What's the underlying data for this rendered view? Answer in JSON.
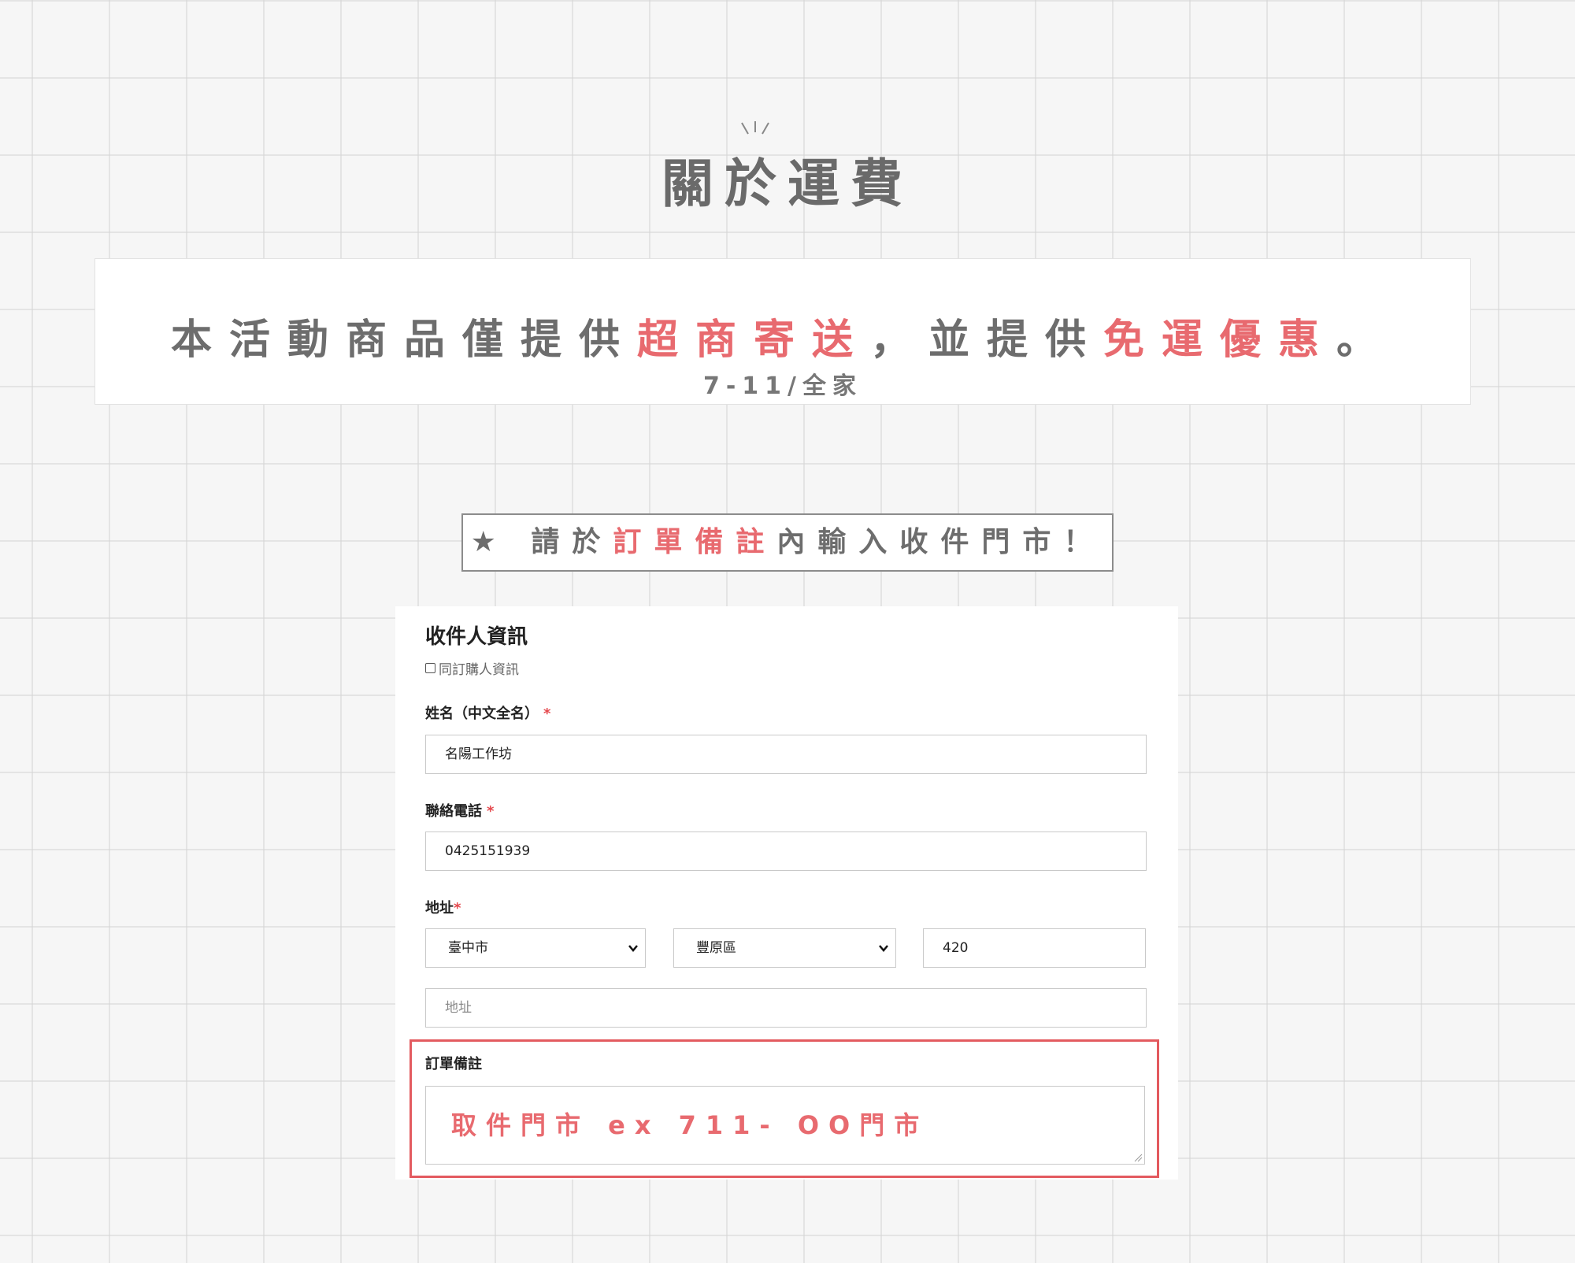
{
  "header": {
    "title": "關於運費",
    "sparkle_icon": "sparkle-icon"
  },
  "banner": {
    "segments": [
      "本活動商品僅提供",
      "超商寄送",
      "，並提供",
      "免運優惠",
      "。"
    ],
    "subtitle": "7-11/全家",
    "highlight_color": "#e86a6f"
  },
  "notice": {
    "star": "★",
    "pre": "請於",
    "highlight": "訂單備註",
    "post": "內輸入收件門市！"
  },
  "form": {
    "heading": "收件人資訊",
    "same_as_buyer_label": "同訂購人資訊",
    "name": {
      "label": "姓名（中文全名）",
      "required_mark": "*",
      "value": "名陽工作坊"
    },
    "phone": {
      "label": "聯絡電話",
      "required_mark": "*",
      "value": "0425151939"
    },
    "address": {
      "label": "地址",
      "required_mark": "*",
      "city": "臺中市",
      "district": "豐原區",
      "zip": "420",
      "street_placeholder": "地址"
    },
    "remark": {
      "label": "訂單備註",
      "value": "取件門市 ex 711- OO門市"
    }
  }
}
